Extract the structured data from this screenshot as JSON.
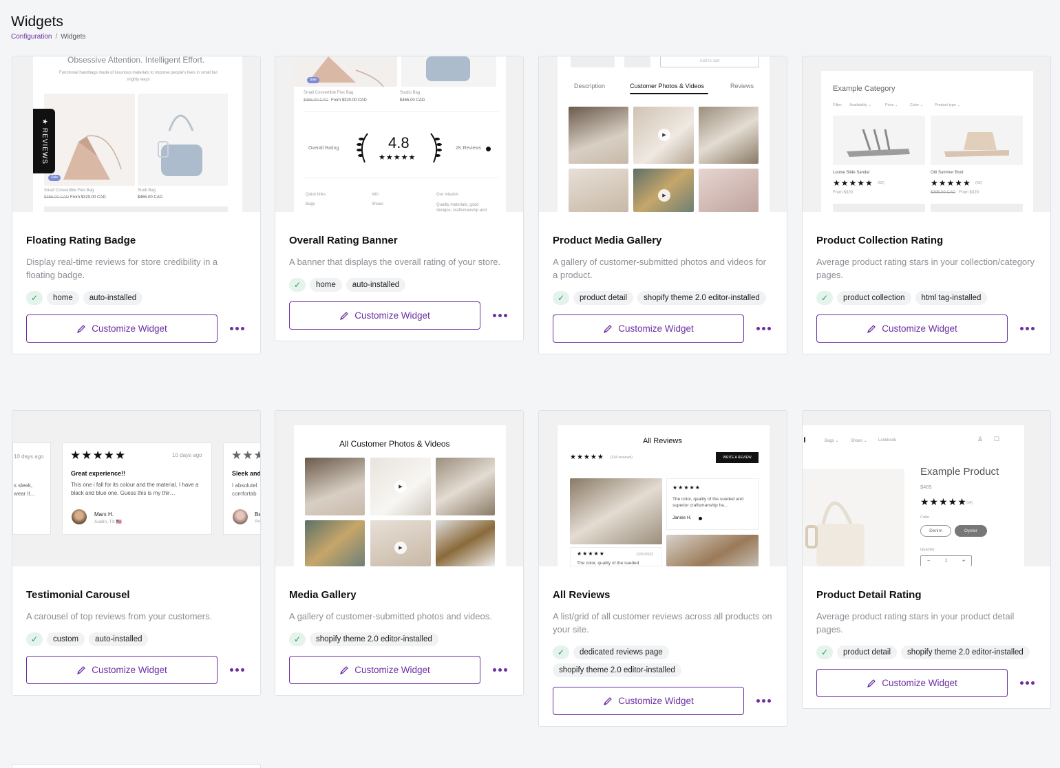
{
  "header": {
    "title": "Widgets",
    "breadcrumb_link": "Configuration",
    "breadcrumb_sep": "/",
    "breadcrumb_current": "Widgets"
  },
  "colors": {
    "accent": "#6b2fa3",
    "check_bg": "#e4f4ec",
    "check_fg": "#2f9a5f",
    "page_bg": "#f4f5f7"
  },
  "button_label": "Customize Widget",
  "cards": [
    {
      "title": "Floating Rating Badge",
      "description": "Display real-time reviews for store credibility in a floating badge.",
      "tags": [
        "home",
        "auto-installed"
      ],
      "preview": {
        "heading": "Obsessive Attention. Intelligent Effort.",
        "subtext": "Functional handbags made of luxurious materials to improve people's lives in small but mighty ways",
        "badge": "★ REVIEWS",
        "sale": "Sale",
        "item1": "Small Convertible Flex Bag",
        "item1_old": "$365.00 CAD",
        "item1_price": "From $320.00 CAD",
        "item2": "Studi Bag",
        "item2_price": "$465.00 CAD"
      }
    },
    {
      "title": "Overall Rating Banner",
      "description": "A banner that displays the overall rating of your store.",
      "tags": [
        "home",
        "auto-installed"
      ],
      "preview": {
        "sale": "Sale",
        "item1": "Small Convertible Flex Bag",
        "item1_old": "$365.00 CAD",
        "item1_price": "From $320.00 CAD",
        "item2": "Studio Bag",
        "item2_price": "$465.00 CAD",
        "overall_label": "Overall Rating",
        "rating": "4.8",
        "stars": "★★★★★",
        "reviews": "2K Reviews",
        "footer1": "Quick links",
        "footer2": "Info",
        "footer3": "Our mission",
        "footer1b": "Bags",
        "footer2b": "Shoes",
        "footer3b": "Quality materials, good designs, craftsmanship and sustainability"
      }
    },
    {
      "title": "Product Media Gallery",
      "description": "A gallery of customer-submitted photos and videos for a product.",
      "tags": [
        "product detail",
        "shopify theme 2.0 editor-installed"
      ],
      "preview": {
        "add_to_cart": "Add to cart",
        "tab1": "Description",
        "tab2": "Customer Photos & Videos",
        "tab3": "Reviews"
      }
    },
    {
      "title": "Product Collection Rating",
      "description": "Average product rating stars in your collection/category pages.",
      "tags": [
        "product collection",
        "html tag-installed"
      ],
      "preview": {
        "category": "Example Category",
        "filter": "Filter:",
        "f1": "Availability ⌄",
        "f2": "Price ⌄",
        "f3": "Color ⌄",
        "f4": "Product type ⌄",
        "p1": "Louise Slide Sandal",
        "p1_count": "(52)",
        "p1_price": "From $320",
        "p2": "Otti Summer Boot",
        "p2_count": "(52)",
        "p2_old": "$395.00 CAD",
        "p2_price": "From $320",
        "stars": "★★★★★"
      }
    },
    {
      "title": "Testimonial Carousel",
      "description": "A carousel of top reviews from your customers.",
      "tags": [
        "custom",
        "auto-installed"
      ],
      "preview": {
        "left_date": "10 days ago",
        "left_text1": "s sleek,",
        "left_text2": "wear it…",
        "stars": "★★★★★",
        "date": "10 days ago",
        "review_title": "Great experience!!",
        "review_text": "This one i fall for its colour and the material. I have a black and blue one. Guess this is my thir…",
        "author": "Marx H.",
        "location": "Austin, TX 🇺🇸",
        "right_stars": "★★★",
        "right_title": "Sleek and",
        "right_text1": "I absolutel",
        "right_text2": "comfortab",
        "right_author": "Be",
        "right_loc": "Au"
      }
    },
    {
      "title": "Media Gallery",
      "description": "A gallery of customer-submitted photos and videos.",
      "tags": [
        "shopify theme 2.0 editor-installed"
      ],
      "preview": {
        "heading": "All Customer Photos & Videos"
      }
    },
    {
      "title": "All Reviews",
      "description": "A list/grid of all customer reviews across all products on your site.",
      "tags": [
        "dedicated reviews page",
        "shopify theme 2.0 editor-installed"
      ],
      "preview": {
        "heading": "All Reviews",
        "stars": "★★★★★",
        "count": "(134 reviews)",
        "write": "WRITE A REVIEW",
        "review_text": "The color, quality of the sueded and superior craftsmanship ha…",
        "review_date": "12/07/2023",
        "author": "Jannie H.",
        "review2_date": "12/07/2023",
        "review2_text": "The color, quality of the sueded"
      }
    },
    {
      "title": "Product Detail Rating",
      "description": "Average product rating stars in your product detail pages.",
      "tags": [
        "product detail",
        "shopify theme 2.0 editor-installed"
      ],
      "preview": {
        "nav1": "Bags ⌄",
        "nav2": "Shoes ⌄",
        "nav3": "Lookbook",
        "product": "Example Product",
        "price": "$465",
        "stars": "★★★★★",
        "count": "(14)",
        "color_label": "Color",
        "opt1": "Denim",
        "opt2": "Oyster",
        "qty_label": "Quantity",
        "qty_minus": "−",
        "qty_val": "1",
        "qty_plus": "+"
      }
    }
  ]
}
